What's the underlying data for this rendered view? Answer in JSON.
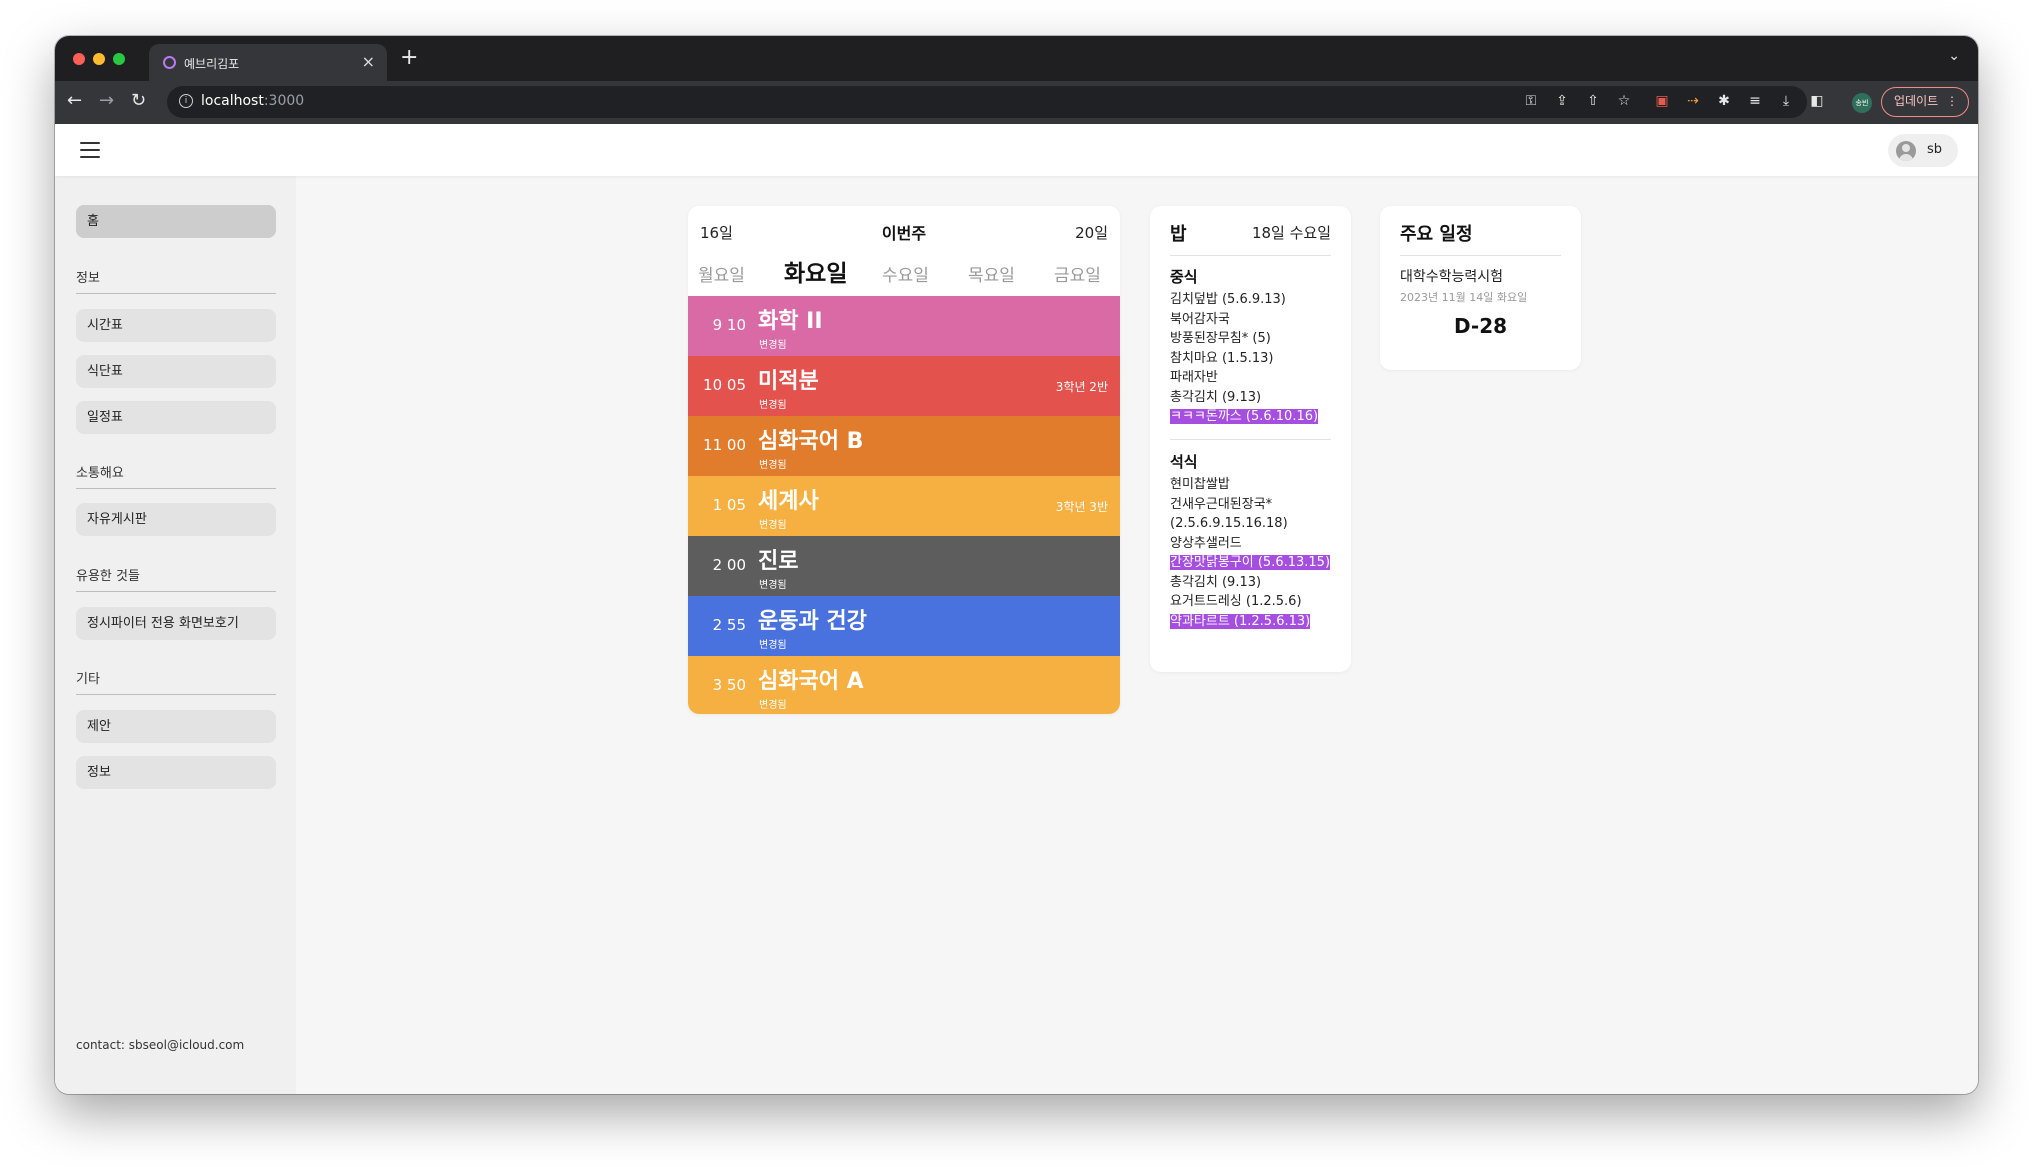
{
  "browser": {
    "tab_title": "예브리김포",
    "tab_close": "×",
    "new_tab": "+",
    "tab_menu": "⌄",
    "url_host": "localhost",
    "url_port": ":3000",
    "nav": {
      "back": "←",
      "forward": "→",
      "reload": "↻",
      "info": "i"
    },
    "toolbar_icons": {
      "key": "⚿",
      "share_page": "⇪",
      "share": "⇧",
      "star": "☆",
      "ext1": "▣",
      "ext2": "⇢",
      "puzzle": "✱",
      "playlist": "≡",
      "download": "⤓",
      "sidepanel": "◧"
    },
    "profile_chip": "송빈",
    "update_label": "업데이트",
    "update_menu": "⋮",
    "traffic_colors": [
      "#ff5f57",
      "#febc2e",
      "#28c840"
    ]
  },
  "app": {
    "user_name": "sb"
  },
  "sidebar": {
    "home": "홈",
    "sections": [
      {
        "title": "정보",
        "items": [
          "시간표",
          "식단표",
          "일정표"
        ]
      },
      {
        "title": "소통해요",
        "items": [
          "자유게시판"
        ]
      },
      {
        "title": "유용한 것들",
        "items": [
          "정시파이터 전용 화면보호기"
        ]
      },
      {
        "title": "기타",
        "items": [
          "제안",
          "정보"
        ]
      }
    ],
    "contact": "contact: sbseol@icloud.com"
  },
  "timetable": {
    "week_start": "16일",
    "week_label": "이번주",
    "week_end": "20일",
    "days": [
      "월요일",
      "화요일",
      "수요일",
      "목요일",
      "금요일"
    ],
    "selected_day": "화요일",
    "periods": [
      {
        "time": "9 10",
        "subject": "화학 II",
        "note": "변경됨",
        "class": "",
        "color": "#d96aa5"
      },
      {
        "time": "10 05",
        "subject": "미적분",
        "note": "변경됨",
        "class": "3학년 2반",
        "color": "#e3524d"
      },
      {
        "time": "11 00",
        "subject": "심화국어 B",
        "note": "변경됨",
        "class": "",
        "color": "#e07c2c"
      },
      {
        "time": "1 05",
        "subject": "세계사",
        "note": "변경됨",
        "class": "3학년 3반",
        "color": "#f6b042"
      },
      {
        "time": "2 00",
        "subject": "진로",
        "note": "변경됨",
        "class": "",
        "color": "#5d5d5d"
      },
      {
        "time": "2 55",
        "subject": "운동과 건강",
        "note": "변경됨",
        "class": "",
        "color": "#4a72df"
      },
      {
        "time": "3 50",
        "subject": "심화국어 A",
        "note": "변경됨",
        "class": "",
        "color": "#f6b042"
      }
    ]
  },
  "meal": {
    "title": "밥",
    "date": "18일 수요일",
    "lunch_label": "중식",
    "lunch": [
      "김치덮밥 (5.6.9.13)",
      "북어감자국",
      "방풍된장무침* (5)",
      "참치마요 (1.5.13)",
      "파래자반",
      "총각김치 (9.13)",
      "ㅋㅋㅋ돈까스 (5.6.10.16)"
    ],
    "lunch_highlight": "ㅋㅋㅋ돈까스 (5.6.10.16)",
    "dinner_label": "석식",
    "dinner": [
      "현미찹쌀밥",
      "건새우근대된장국* (2.5.6.9.15.16.18)",
      "양상추샐러드",
      "간장맛닭봉구이 (5.6.13.15)",
      "총각김치 (9.13)",
      "요거트드레싱 (1.2.5.6)",
      "약과타르트 (1.2.5.6.13)"
    ],
    "dinner_highlights": [
      "간장맛닭봉구이 (5.6.13.15)",
      "약과타르트 (1.2.5.6.13)"
    ],
    "highlight_color": "#a54ee0"
  },
  "schedule": {
    "title": "주요 일정",
    "event_name": "대학수학능력시험",
    "event_date": "2023년 11월 14일 화요일",
    "dday": "D-28"
  }
}
